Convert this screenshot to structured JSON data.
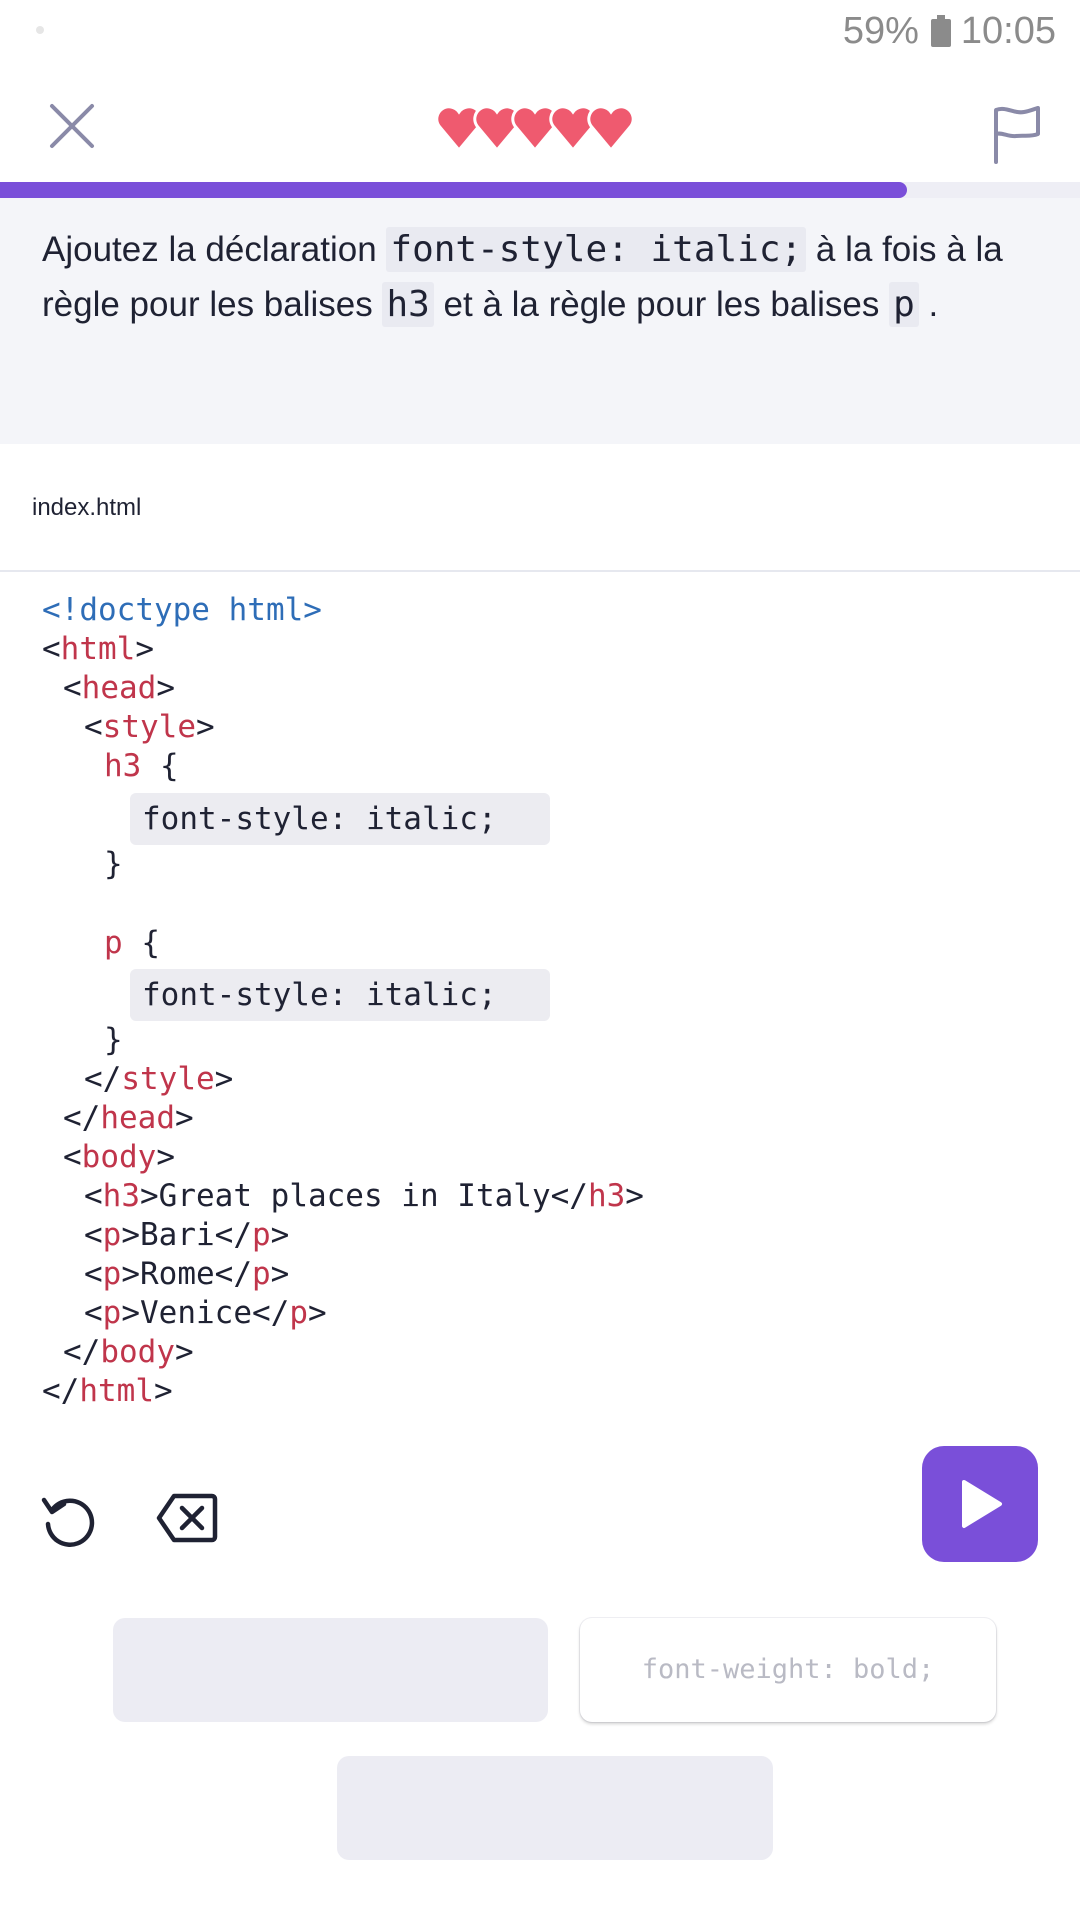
{
  "status_bar": {
    "battery": "59%",
    "time": "10:05"
  },
  "header": {
    "close_icon": "close-icon",
    "hearts_icon": "hearts-icon",
    "flag_icon": "flag-icon",
    "lives": 5
  },
  "progress": {
    "fraction": 0.84,
    "color": "#7a4fd9"
  },
  "instruction": {
    "prefix": "Ajoutez la déclaration ",
    "declaration": "font-style: italic;",
    "middle1": " à la fois à la règle pour les balises ",
    "tag1": "h3",
    "middle2": " et à la règle pour les balises ",
    "tag2": "p",
    "suffix": " ."
  },
  "file": {
    "name": "index.html"
  },
  "code": {
    "doctype": "<!doctype html>",
    "html_tag": "html",
    "head_tag": "head",
    "style_tag": "style",
    "h3_selector": "h3",
    "p_selector": "p",
    "open_brace": " {",
    "close_brace": "}",
    "slot1_value": "font-style: italic;",
    "slot2_value": "font-style: italic;",
    "body_tag": "body",
    "h3_tag": "h3",
    "h3_text": "Great places in Italy",
    "p_tag": "p",
    "p1_text": "Bari",
    "p2_text": "Rome",
    "p3_text": "Venice"
  },
  "toolbar": {
    "reset_icon": "reset-icon",
    "clear_icon": "backspace-icon",
    "run_icon": "play-icon"
  },
  "options": {
    "option2_label": "font-weight: bold;"
  },
  "colors": {
    "accent": "#7a4fd9",
    "heart": "#ef5a6f",
    "tag": "#c0354b",
    "doctype": "#2e6db7"
  }
}
